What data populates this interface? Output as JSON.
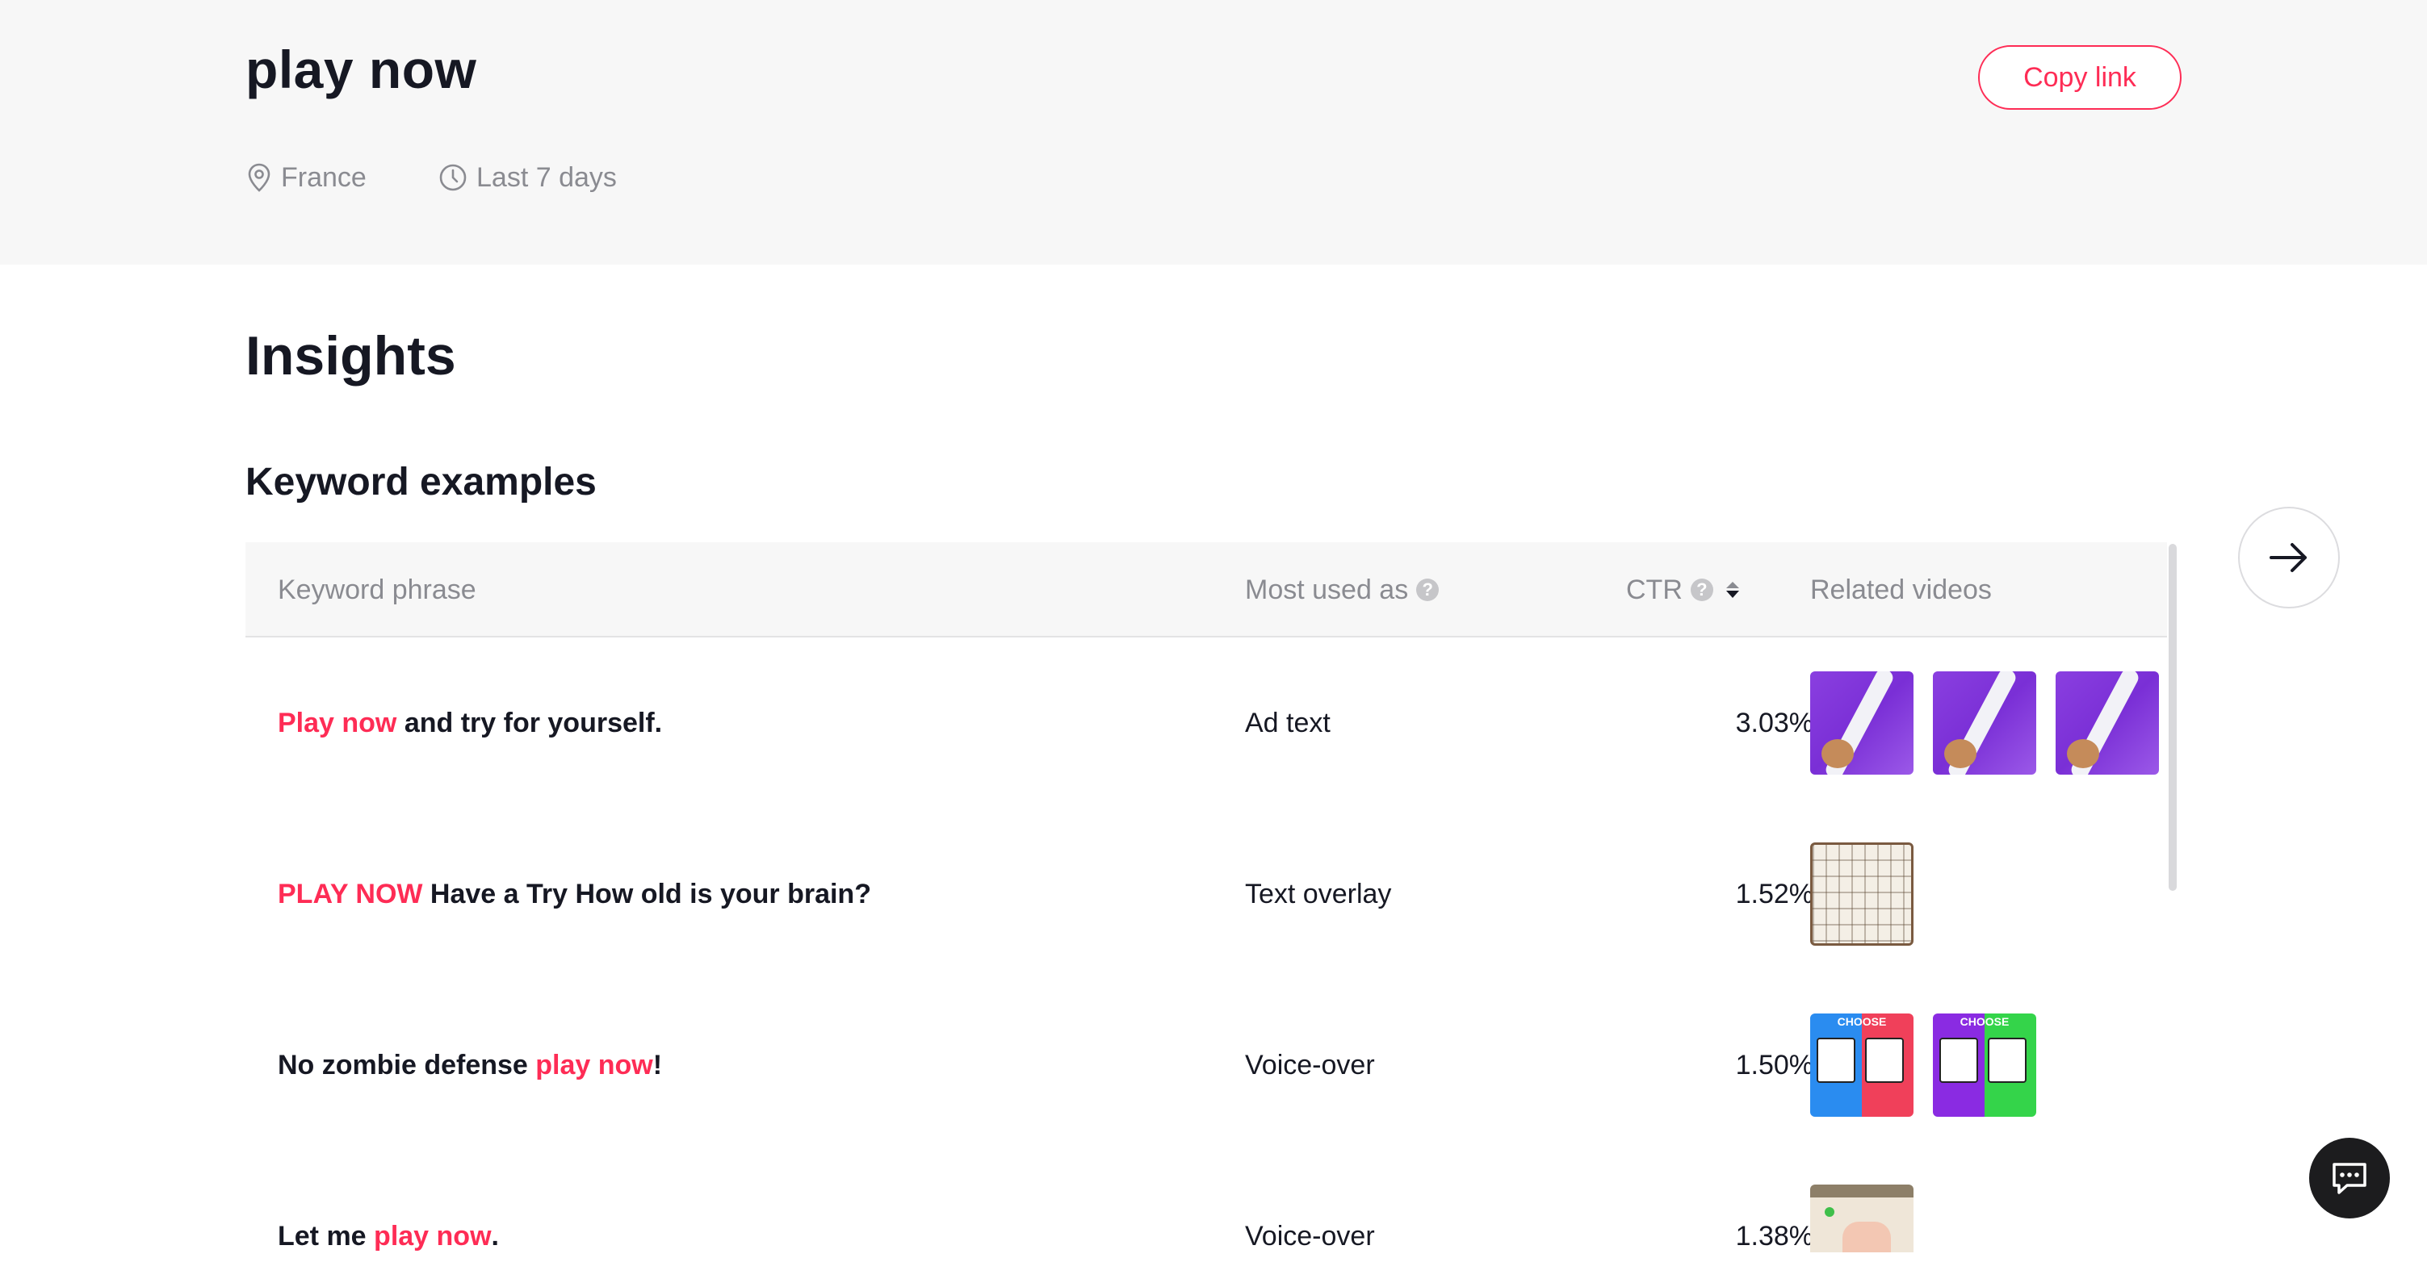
{
  "header": {
    "title": "play now",
    "copy_link_label": "Copy link",
    "location": "France",
    "period": "Last 7 days"
  },
  "insights": {
    "title": "Insights",
    "section_title": "Keyword examples"
  },
  "table": {
    "columns": {
      "phrase": "Keyword phrase",
      "used_as": "Most used as",
      "ctr": "CTR",
      "videos": "Related videos"
    },
    "rows": [
      {
        "keyword": "Play now",
        "before": "",
        "after": " and try for yourself.",
        "used_as": "Ad text",
        "ctr": "3.03%"
      },
      {
        "keyword": "PLAY NOW",
        "before": "",
        "after": " Have a Try How old is your brain?",
        "used_as": "Text overlay",
        "ctr": "1.52%"
      },
      {
        "keyword": "play now",
        "before": "No zombie defense ",
        "after": "!",
        "used_as": "Voice-over",
        "ctr": "1.50%"
      },
      {
        "keyword": "play now",
        "before": "Let me ",
        "after": ".",
        "used_as": "Voice-over",
        "ctr": "1.38%"
      }
    ],
    "thumb_labels": {
      "choose": "CHOOSE"
    }
  },
  "colors": {
    "accent": "#fe2c55",
    "muted": "#8a8b91",
    "header_bg": "#f7f7f7"
  }
}
